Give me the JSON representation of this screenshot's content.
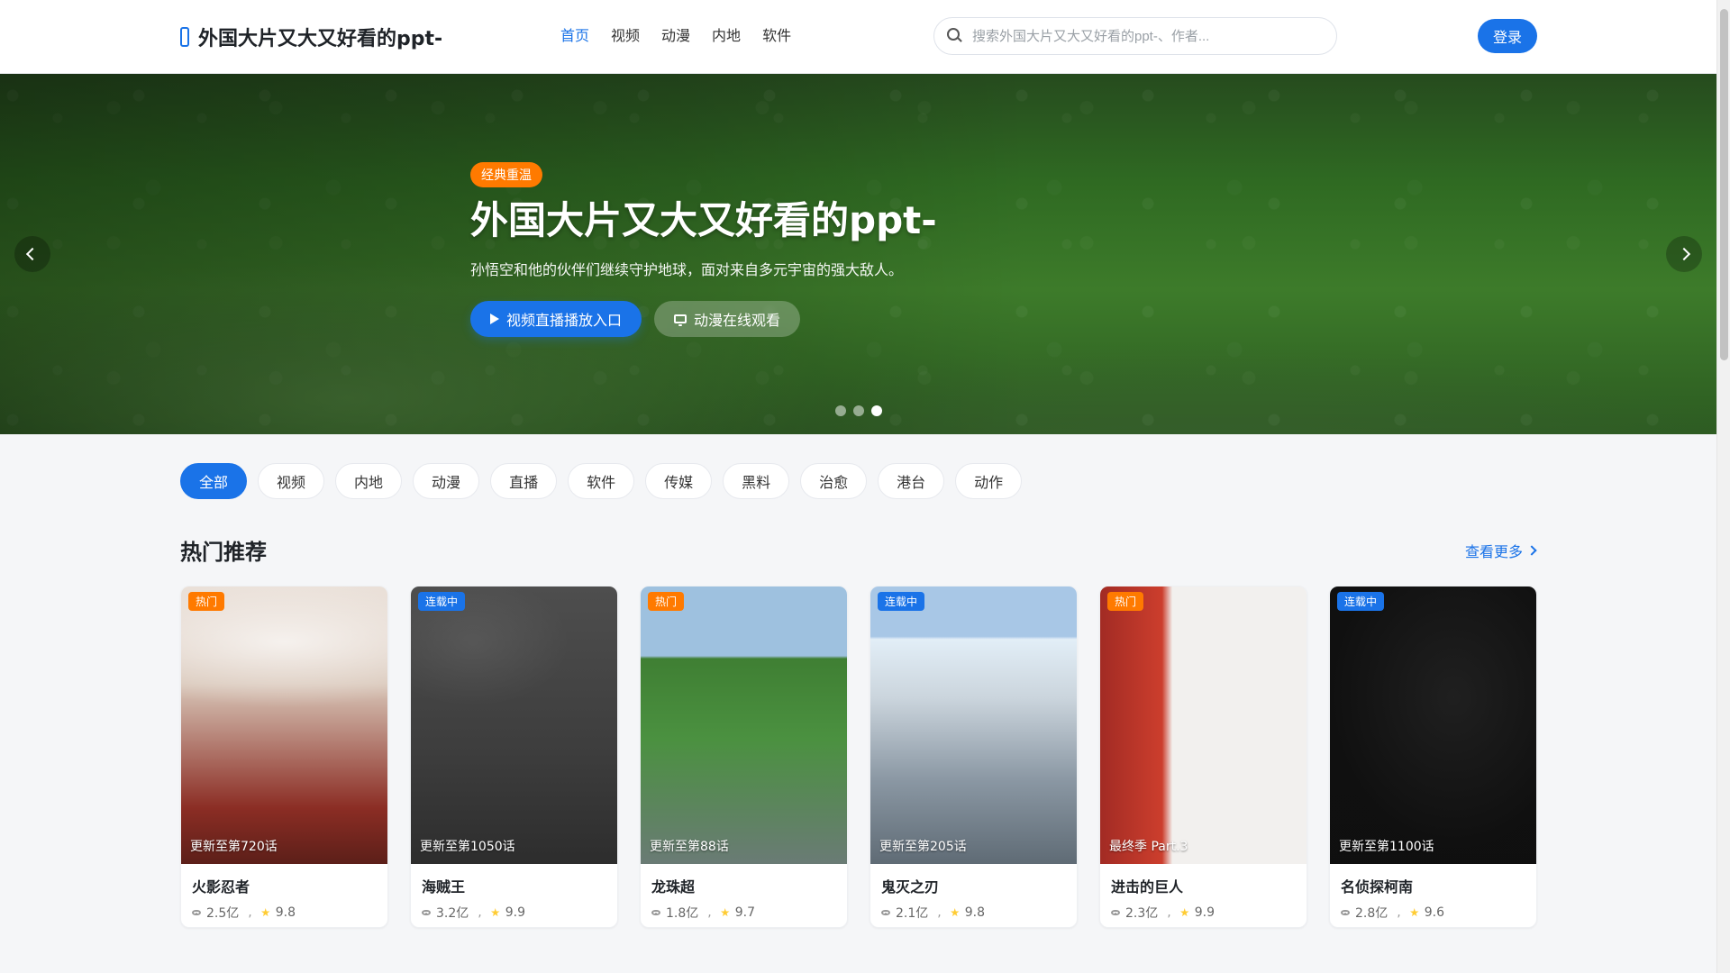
{
  "header": {
    "brand_title": "外国大片又大又好看的ppt-",
    "nav": [
      {
        "label": "首页",
        "active": true
      },
      {
        "label": "视频"
      },
      {
        "label": "动漫"
      },
      {
        "label": "内地"
      },
      {
        "label": "软件"
      }
    ],
    "search": {
      "placeholder": "搜索外国大片又大又好看的ppt-、作者..."
    },
    "login_label": "登录"
  },
  "hero": {
    "badge": "经典重温",
    "title": "外国大片又大又好看的ppt-",
    "description": "孙悟空和他的伙伴们继续守护地球，面对来自多元宇宙的强大敌人。",
    "primary_btn": "视频直播播放入口",
    "secondary_btn": "动漫在线观看",
    "dots": 3,
    "active_dot": 3
  },
  "categories": [
    {
      "label": "全部",
      "active": true
    },
    {
      "label": "视频"
    },
    {
      "label": "内地"
    },
    {
      "label": "动漫"
    },
    {
      "label": "直播"
    },
    {
      "label": "软件"
    },
    {
      "label": "传媒"
    },
    {
      "label": "黑料"
    },
    {
      "label": "治愈"
    },
    {
      "label": "港台"
    },
    {
      "label": "动作"
    }
  ],
  "section": {
    "title": "热门推荐",
    "see_more": "查看更多"
  },
  "cards": [
    {
      "title": "火影忍者",
      "badge": "热门",
      "badge_type": "hot",
      "update": "更新至第720话",
      "views": "2.5亿",
      "rating": "9.8",
      "art": "book"
    },
    {
      "title": "海贼王",
      "badge": "连载中",
      "badge_type": "serial",
      "update": "更新至第1050话",
      "views": "3.2亿",
      "rating": "9.9",
      "art": "items"
    },
    {
      "title": "龙珠超",
      "badge": "热门",
      "badge_type": "hot",
      "update": "更新至第88话",
      "views": "1.8亿",
      "rating": "9.7",
      "art": "forest"
    },
    {
      "title": "鬼灭之刃",
      "badge": "连载中",
      "badge_type": "serial",
      "update": "更新至第205话",
      "views": "2.1亿",
      "rating": "9.8",
      "art": "mountain"
    },
    {
      "title": "进击的巨人",
      "badge": "热门",
      "badge_type": "hot",
      "update": "最终季 Part.3",
      "views": "2.3亿",
      "rating": "9.9",
      "art": "mug"
    },
    {
      "title": "名侦探柯南",
      "badge": "连载中",
      "badge_type": "serial",
      "update": "更新至第1100话",
      "views": "2.8亿",
      "rating": "9.6",
      "art": "feet"
    }
  ],
  "icons": {
    "brand": "brand-icon",
    "search": "search-icon",
    "prev": "chevron-left-icon",
    "next": "chevron-right-icon",
    "play": "play-icon",
    "tv": "tv-icon",
    "views": "views-icon",
    "rating": "star-icon",
    "see_more": "chevron-right-icon"
  },
  "colors": {
    "accent": "#1a73e8",
    "badge_hot": "#ff7a00",
    "badge_serial": "#1a73e8",
    "header_bg": "#ffffff",
    "page_bg": "#f5f6f8"
  }
}
